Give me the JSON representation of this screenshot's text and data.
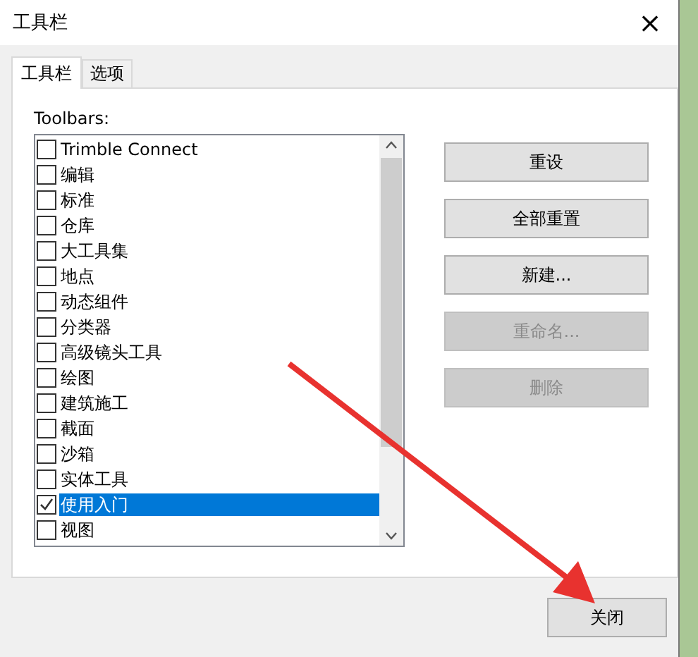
{
  "window": {
    "title": "工具栏",
    "close": "×"
  },
  "tabs": [
    {
      "label": "工具栏",
      "selected": true
    },
    {
      "label": "选项",
      "selected": false
    }
  ],
  "list_label": "Toolbars:",
  "toolbars": [
    {
      "label": "Trimble Connect",
      "checked": false,
      "selected": false
    },
    {
      "label": "编辑",
      "checked": false,
      "selected": false
    },
    {
      "label": "标准",
      "checked": false,
      "selected": false
    },
    {
      "label": "仓库",
      "checked": false,
      "selected": false
    },
    {
      "label": "大工具集",
      "checked": false,
      "selected": false
    },
    {
      "label": "地点",
      "checked": false,
      "selected": false
    },
    {
      "label": "动态组件",
      "checked": false,
      "selected": false
    },
    {
      "label": "分类器",
      "checked": false,
      "selected": false
    },
    {
      "label": "高级镜头工具",
      "checked": false,
      "selected": false
    },
    {
      "label": "绘图",
      "checked": false,
      "selected": false
    },
    {
      "label": "建筑施工",
      "checked": false,
      "selected": false
    },
    {
      "label": "截面",
      "checked": false,
      "selected": false
    },
    {
      "label": "沙箱",
      "checked": false,
      "selected": false
    },
    {
      "label": "实体工具",
      "checked": false,
      "selected": false
    },
    {
      "label": "使用入门",
      "checked": true,
      "selected": true
    },
    {
      "label": "视图",
      "checked": false,
      "selected": false
    }
  ],
  "buttons": [
    {
      "label": "重设",
      "disabled": false
    },
    {
      "label": "全部重置",
      "disabled": false
    },
    {
      "label": "新建...",
      "disabled": false
    },
    {
      "label": "重命名...",
      "disabled": true
    },
    {
      "label": "删除",
      "disabled": true
    }
  ],
  "footer_button": "关闭"
}
